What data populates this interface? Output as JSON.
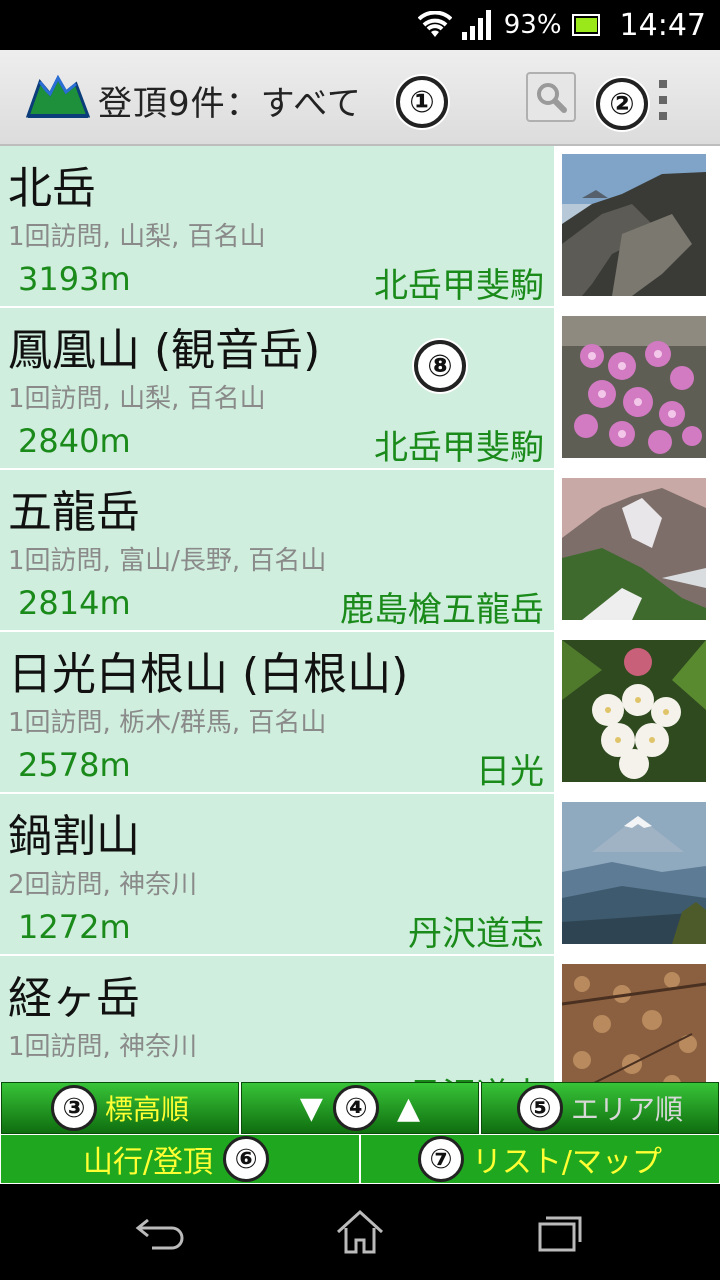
{
  "status": {
    "battery": "93%",
    "time": "14:47"
  },
  "header": {
    "title": "登頂9件：すべて",
    "badges": {
      "title": "①",
      "menu": "②"
    }
  },
  "list_badge": "⑧",
  "summits": [
    {
      "name": "北岳",
      "meta": "1回訪問, 山梨, 百名山",
      "elevation": "3193m",
      "area": "北岳甲斐駒",
      "photo": "rocky-ridge"
    },
    {
      "name": "鳳凰山 (観音岳)",
      "meta": "1回訪問, 山梨, 百名山",
      "elevation": "2840m",
      "area": "北岳甲斐駒",
      "photo": "pink-flowers"
    },
    {
      "name": "五龍岳",
      "meta": "1回訪問, 富山/長野, 百名山",
      "elevation": "2814m",
      "area": "鹿島槍五龍岳",
      "photo": "mountain-snow"
    },
    {
      "name": "日光白根山 (白根山)",
      "meta": "1回訪問, 栃木/群馬, 百名山",
      "elevation": "2578m",
      "area": "日光",
      "photo": "white-flowers"
    },
    {
      "name": "鍋割山",
      "meta": "2回訪問, 神奈川",
      "elevation": "1272m",
      "area": "丹沢道志",
      "photo": "fuji-view"
    },
    {
      "name": "経ヶ岳",
      "meta": "1回訪問, 神奈川",
      "elevation": "",
      "area": "丹沢道志",
      "photo": "leaf-litter"
    }
  ],
  "sort": {
    "elevation_label": "標高順",
    "elevation_badge": "③",
    "order_badge": "④",
    "order_down": "▼",
    "order_up": "▲",
    "area_label": "エリア順",
    "area_badge": "⑤"
  },
  "modes": {
    "climb_label": "山行/登頂",
    "climb_badge": "⑥",
    "view_label": "リスト/マップ",
    "view_badge": "⑦"
  },
  "colors": {
    "accent_green": "#1fa81f",
    "row_bg": "#cfeedd",
    "label_yellow": "#ffff33",
    "elevation_green": "#1a8a1a"
  }
}
